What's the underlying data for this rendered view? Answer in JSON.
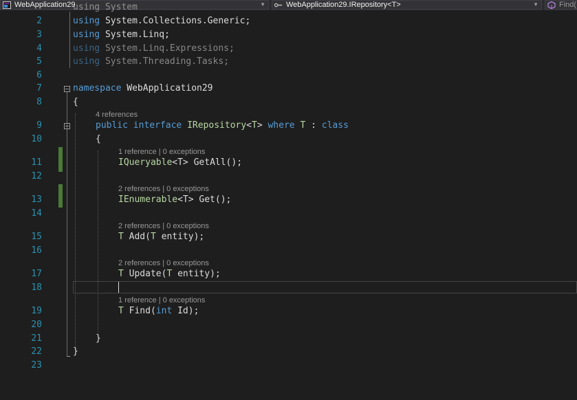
{
  "navbar": {
    "project": "WebApplication29",
    "type_scope": "WebApplication29.IRepository<T>",
    "member": "Find("
  },
  "editor": {
    "line_numbers": [
      "2",
      "3",
      "4",
      "5",
      "6",
      "7",
      "8",
      "9",
      "10",
      "11",
      "12",
      "13",
      "14",
      "15",
      "16",
      "17",
      "18",
      "19",
      "20",
      "21",
      "22",
      "23"
    ],
    "lines": {
      "l1_partial": "using System",
      "l2": {
        "kw": "using",
        "rest": " System.Collections.Generic;"
      },
      "l3": {
        "kw": "using",
        "rest": " System.Linq;"
      },
      "l4": {
        "kw": "using",
        "rest": " System.Linq.Expressions;"
      },
      "l5": {
        "kw": "using",
        "rest": " System.Threading.Tasks;"
      },
      "l7": {
        "kw": "namespace",
        "rest": " WebApplication29"
      },
      "l8": "{",
      "l9": {
        "kw1": "public",
        "kw2": "interface",
        "name": "IRepository",
        "gen_open": "<",
        "gen_t": "T",
        "gen_close": ">",
        "kw3": "where",
        "t2": "T",
        "colon": " : ",
        "kw4": "class"
      },
      "l10": "{",
      "l11": {
        "type": "IQueryable",
        "gen": "<T>",
        "rest": " GetAll();"
      },
      "l13": {
        "type": "IEnumerable",
        "gen": "<T>",
        "rest": " Get();"
      },
      "l15": {
        "t": "T",
        "rest": " Add(",
        "pt": "T",
        "param": " entity",
        "end": ");"
      },
      "l17": {
        "t": "T",
        "rest": " Update(",
        "pt": "T",
        "param": " entity",
        "end": ");"
      },
      "l19": {
        "t": "T",
        "rest": " Find(",
        "kw": "int",
        "param": " Id",
        "end": ");"
      },
      "l21": "}",
      "l22": "}"
    },
    "codelens": {
      "interface": "4 references",
      "getall": {
        "refs": "1 reference",
        "sep": " | ",
        "exc": "0 exceptions"
      },
      "get": {
        "refs": "2 references",
        "sep": " | ",
        "exc": "0 exceptions"
      },
      "add": {
        "refs": "2 references",
        "sep": " | ",
        "exc": "0 exceptions"
      },
      "update": {
        "refs": "2 references",
        "sep": " | ",
        "exc": "0 exceptions"
      },
      "find": {
        "refs": "1 reference",
        "sep": " | ",
        "exc": "0 exceptions"
      }
    }
  },
  "colors": {
    "background": "#1e1e1e",
    "keyword": "#569cd6",
    "type": "#b8d7a3",
    "line_number": "#2b91af",
    "text": "#dcdcdc",
    "codelens": "#999999",
    "modified_marker": "#4b7a37"
  },
  "icons": {
    "project": "csharp-project-icon",
    "type_scope": "interface-icon",
    "member": "method-icon"
  }
}
